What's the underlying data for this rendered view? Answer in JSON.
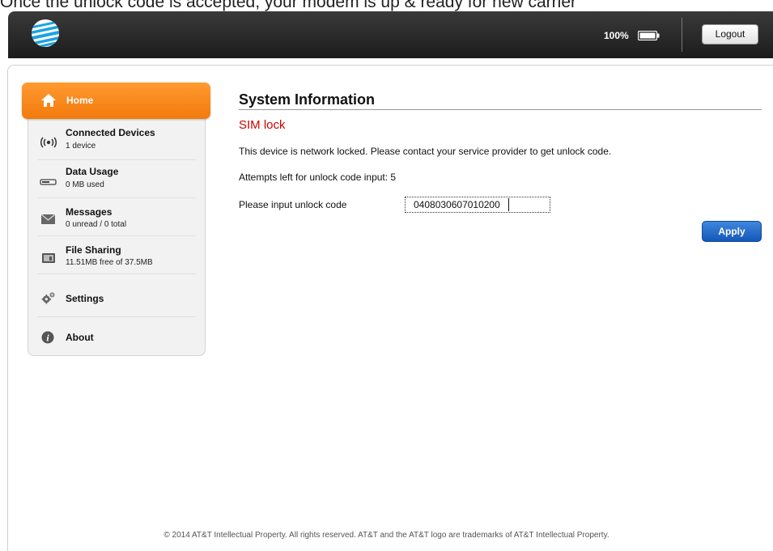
{
  "caption": "Once the unlock code is accepted, your modem is up & ready for new carrier",
  "header": {
    "battery_text": "100%",
    "logout_label": "Logout"
  },
  "sidebar": {
    "home_label": "Home",
    "items": [
      {
        "title": "Connected Devices",
        "subtitle": "1 device",
        "icon": "wireless-icon"
      },
      {
        "title": "Data Usage",
        "subtitle": "0 MB used",
        "icon": "data-bar-icon"
      },
      {
        "title": "Messages",
        "subtitle": "0 unread / 0 total",
        "icon": "envelope-icon"
      },
      {
        "title": "File Sharing",
        "subtitle": "11.51MB free of 37.5MB",
        "icon": "sd-card-icon"
      },
      {
        "title": "Settings",
        "subtitle": "",
        "icon": "gears-icon"
      },
      {
        "title": "About",
        "subtitle": "",
        "icon": "info-icon"
      }
    ]
  },
  "main": {
    "title": "System Information",
    "section": "SIM lock",
    "message": "This device is network locked. Please contact your service provider to get unlock code.",
    "attempts": "Attempts left for unlock code input: 5",
    "input_label": "Please input unlock code",
    "input_value": "0408030607010200",
    "apply_label": "Apply"
  },
  "footer": "© 2014 AT&T Intellectual Property. All rights reserved. AT&T and the AT&T logo are trademarks of AT&T Intellectual Property.",
  "colors": {
    "accent_orange": "#f27a0c",
    "section_red": "#cc0000",
    "apply_blue": "#1458b8",
    "header_dark": "#1c1c1c"
  }
}
